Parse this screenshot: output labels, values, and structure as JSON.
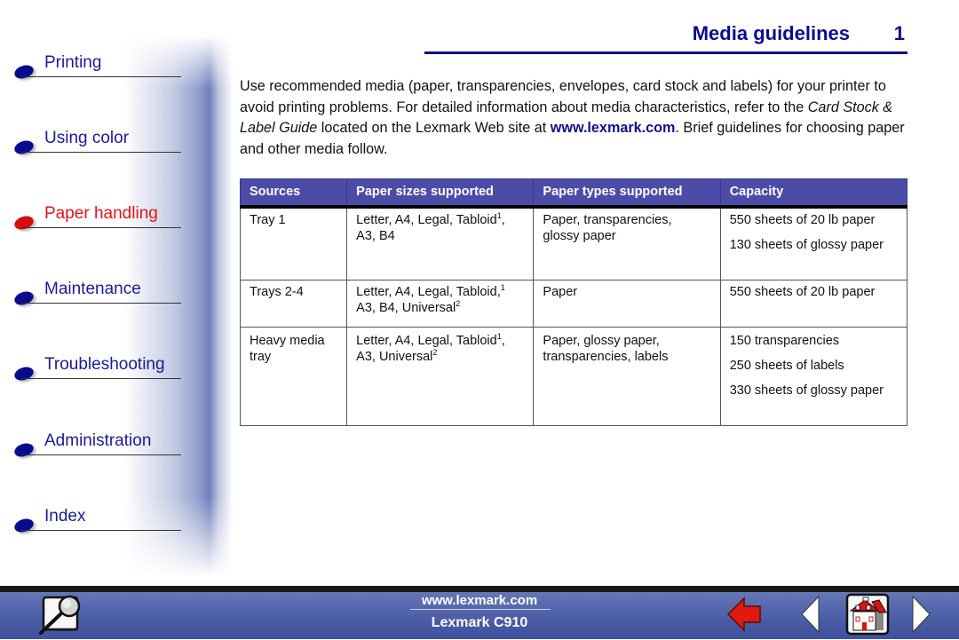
{
  "sidebar": {
    "items": [
      {
        "label": "Printing",
        "active": false
      },
      {
        "label": "Using color",
        "active": false
      },
      {
        "label": "Paper handling",
        "active": true
      },
      {
        "label": "Maintenance",
        "active": false
      },
      {
        "label": "Troubleshooting",
        "active": false
      },
      {
        "label": "Administration",
        "active": false
      },
      {
        "label": "Index",
        "active": false
      }
    ]
  },
  "header": {
    "title": "Media guidelines",
    "page_number": "1"
  },
  "intro": {
    "part1": "Use recommended media (paper, transparencies, envelopes, card stock and labels) for your printer to avoid printing problems. For detailed information about media characteristics, refer to the ",
    "guide_title": "Card Stock & Label Guide",
    "part2": " located on the Lexmark Web site at ",
    "link": "www.lexmark.com",
    "part3": ". Brief guidelines for choosing paper and other media follow."
  },
  "table": {
    "headers": [
      "Sources",
      "Paper sizes supported",
      "Paper types supported",
      "Capacity"
    ],
    "rows": [
      {
        "source": "Tray 1",
        "sizes_a": "Letter, A4, Legal, Tabloid",
        "sizes_a_sup": "1",
        "sizes_a_tail": ",",
        "sizes_b": "A3, B4",
        "sizes_b_sup": "",
        "types": "Paper, transparencies, glossy paper",
        "capacity": [
          "550 sheets of 20 lb paper",
          "130 sheets of glossy paper"
        ]
      },
      {
        "source": "Trays 2-4",
        "sizes_a": "Letter, A4, Legal, Tabloid,",
        "sizes_a_sup": "1",
        "sizes_a_tail": "",
        "sizes_b": "A3, B4, Universal",
        "sizes_b_sup": "2",
        "types": "Paper",
        "capacity": [
          "550 sheets of 20 lb paper"
        ]
      },
      {
        "source": "Heavy media tray",
        "sizes_a": "Letter, A4, Legal, Tabloid",
        "sizes_a_sup": "1",
        "sizes_a_tail": ",",
        "sizes_b": "A3, Universal",
        "sizes_b_sup": "2",
        "types": "Paper, glossy paper, transparencies, labels",
        "capacity": [
          "150 transparencies",
          "250 sheets of labels",
          "330 sheets of glossy paper"
        ]
      }
    ]
  },
  "footer": {
    "url": "www.lexmark.com",
    "model": "Lexmark C910",
    "icons": [
      "search-icon",
      "back-arrow-icon",
      "previous-page-icon",
      "home-icon",
      "next-page-icon"
    ]
  },
  "colors": {
    "nav_text": "#1b1b94",
    "nav_active": "#e0141a",
    "title": "#0c0c8c",
    "table_header": "#4c4ca8",
    "footer_bg": "#4a5ca4"
  }
}
